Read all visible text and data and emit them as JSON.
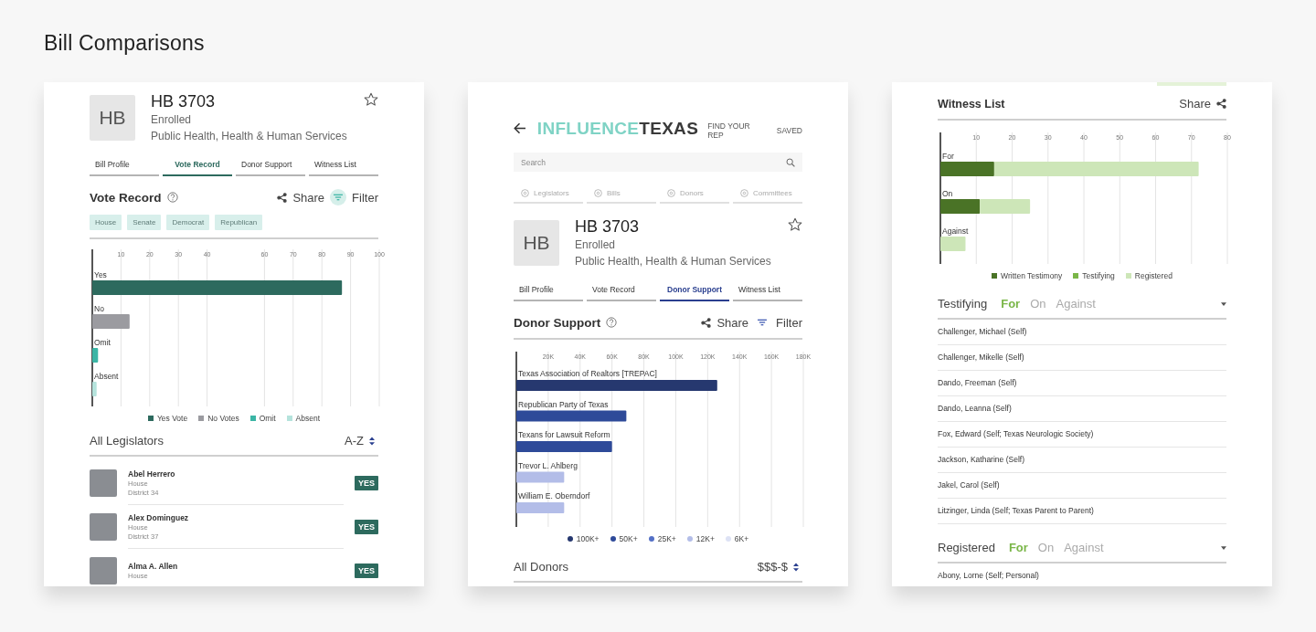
{
  "page_title": "Bill Comparisons",
  "vote_card": {
    "bill": {
      "avatar": "HB",
      "number": "HB 3703",
      "status": "Enrolled",
      "subject": "Public Health, Health & Human Services",
      "saved": false
    },
    "tabs": [
      {
        "label": "Bill Profile",
        "selected": false
      },
      {
        "label": "Vote Record",
        "selected": true
      },
      {
        "label": "Donor Support",
        "selected": false
      },
      {
        "label": "Witness List",
        "selected": false
      }
    ],
    "section": {
      "title": "Vote Record",
      "share": "Share",
      "filter": "Filter",
      "filter_active": true
    },
    "chips": [
      "House",
      "Senate",
      "Democrat",
      "Republican"
    ],
    "chart_data": {
      "type": "bar",
      "orientation": "horizontal",
      "grid": true,
      "legend": "bottom",
      "categories": [
        "Yes",
        "No",
        "Omit",
        "Absent"
      ],
      "xlim": [
        0,
        100
      ],
      "xticks": [
        10,
        20,
        30,
        40,
        60,
        70,
        80,
        90,
        100
      ],
      "series": [
        {
          "name": "Yes Vote",
          "color": "#2d6a5e",
          "values": [
            87,
            null,
            null,
            null
          ]
        },
        {
          "name": "No Votes",
          "color": "#9b9ba0",
          "values": [
            null,
            13,
            null,
            null
          ]
        },
        {
          "name": "Omit",
          "color": "#3bb5a5",
          "values": [
            null,
            null,
            2,
            null
          ]
        },
        {
          "name": "Absent",
          "color": "#b5e3dc",
          "values": [
            null,
            null,
            null,
            1.5
          ]
        }
      ]
    },
    "list": {
      "title": "All Legislators",
      "sort": "A-Z",
      "items": [
        {
          "name": "Abel Herrero",
          "chamber": "House",
          "district": "District 34",
          "vote": "YES"
        },
        {
          "name": "Alex Dominguez",
          "chamber": "House",
          "district": "District 37",
          "vote": "YES"
        },
        {
          "name": "Alma A. Allen",
          "chamber": "House",
          "vote": "YES"
        }
      ]
    }
  },
  "donor_card": {
    "logo": {
      "first": "INFLUENCE",
      "second": "TEXAS"
    },
    "links": [
      "FIND YOUR REP",
      "SAVED"
    ],
    "search": {
      "placeholder": "Search"
    },
    "nav": [
      {
        "label": "Legislators",
        "selected": false
      },
      {
        "label": "Bills",
        "selected": false
      },
      {
        "label": "Donors",
        "selected": false
      },
      {
        "label": "Committees",
        "selected": false
      }
    ],
    "bill": {
      "avatar": "HB",
      "number": "HB 3703",
      "status": "Enrolled",
      "subject": "Public Health, Health & Human Services",
      "saved": false
    },
    "tabs": [
      {
        "label": "Bill Profile",
        "selected": false
      },
      {
        "label": "Vote Record",
        "selected": false
      },
      {
        "label": "Donor Support",
        "selected": true
      },
      {
        "label": "Witness List",
        "selected": false
      }
    ],
    "section": {
      "title": "Donor Support",
      "share": "Share",
      "filter": "Filter",
      "filter_active": false
    },
    "chart_data": {
      "type": "bar",
      "orientation": "horizontal",
      "grid": true,
      "legend": "bottom",
      "categories": [
        "Texas Association of Realtors [TREPAC]",
        "Republican Party of Texas",
        "Texans for Lawsuit Reform",
        "Trevor L. Ahlberg",
        "William E. Oberndorf"
      ],
      "xlim": [
        0,
        180000
      ],
      "xticks": [
        {
          "value": 20000,
          "label": "20K"
        },
        {
          "value": 40000,
          "label": "40K"
        },
        {
          "value": 60000,
          "label": "60K"
        },
        {
          "value": 80000,
          "label": "80K"
        },
        {
          "value": 100000,
          "label": "100K"
        },
        {
          "value": 120000,
          "label": "120K"
        },
        {
          "value": 140000,
          "label": "140K"
        },
        {
          "value": 160000,
          "label": "160K"
        },
        {
          "value": 180000,
          "label": "180K"
        }
      ],
      "series": [
        {
          "name": "100K+",
          "color": "#26386f",
          "values": [
            126000,
            null,
            null,
            null,
            null
          ]
        },
        {
          "name": "50K+",
          "color": "#2e4a99",
          "values": [
            null,
            69000,
            60000,
            null,
            null
          ]
        },
        {
          "name": "25K+",
          "color": "#5470c6",
          "values": [
            null,
            null,
            null,
            null,
            null
          ]
        },
        {
          "name": "12K+",
          "color": "#b3bde8",
          "values": [
            null,
            null,
            null,
            30000,
            30000
          ]
        },
        {
          "name": "6K+",
          "color": "#dde2f5",
          "values": [
            null,
            null,
            null,
            null,
            null
          ]
        }
      ]
    },
    "list": {
      "title": "All Donors",
      "sort": "$$$-$"
    }
  },
  "witness_card": {
    "title": "Witness List",
    "share": "Share",
    "chart_data": {
      "type": "bar",
      "orientation": "horizontal",
      "stacked": true,
      "grid": true,
      "legend": "bottom",
      "categories": [
        "For",
        "On",
        "Against"
      ],
      "xlim": [
        0,
        80
      ],
      "xticks": [
        10,
        20,
        30,
        40,
        50,
        60,
        70,
        80
      ],
      "series": [
        {
          "name": "Written Testimony",
          "color": "#4a7326",
          "values": [
            15,
            11,
            0
          ]
        },
        {
          "name": "Testifying",
          "color": "#7ab648",
          "values": [
            0,
            0,
            0
          ]
        },
        {
          "name": "Registered",
          "color": "#cde6b8",
          "values": [
            57,
            14,
            7
          ]
        }
      ]
    },
    "groups": [
      {
        "title": "Testifying",
        "filters": [
          {
            "label": "For",
            "selected": true
          },
          {
            "label": "On",
            "selected": false
          },
          {
            "label": "Against",
            "selected": false
          }
        ],
        "witnesses": [
          "Challenger, Michael (Self)",
          "Challenger, Mikelle (Self)",
          "Dando, Freeman (Self)",
          "Dando, Leanna (Self)",
          "Fox, Edward (Self; Texas Neurologic Society)",
          "Jackson, Katharine (Self)",
          "Jakel, Carol (Self)",
          "Litzinger, Linda (Self; Texas Parent to Parent)"
        ]
      },
      {
        "title": "Registered",
        "filters": [
          {
            "label": "For",
            "selected": true
          },
          {
            "label": "On",
            "selected": false
          },
          {
            "label": "Against",
            "selected": false
          }
        ],
        "witnesses": [
          "Abony, Lorne (Self; Personal)"
        ]
      }
    ]
  }
}
